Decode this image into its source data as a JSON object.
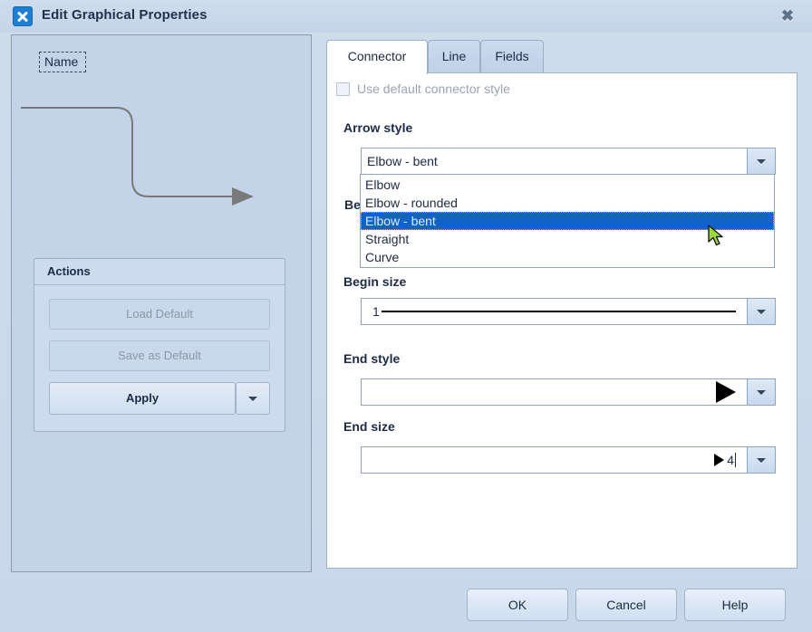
{
  "window": {
    "title": "Edit Graphical Properties",
    "app_icon": "close-x-icon",
    "close_label": "✖"
  },
  "preview": {
    "name_label": "Name",
    "connector_shape": "elbow-rounded-with-arrowhead"
  },
  "actions": {
    "group_title": "Actions",
    "load_default_label": "Load Default",
    "save_as_default_label": "Save as Default",
    "apply_label": "Apply",
    "apply_dropdown_icon": "chevron-down-icon"
  },
  "tabs": [
    {
      "label": "Connector",
      "active": true
    },
    {
      "label": "Line",
      "active": false
    },
    {
      "label": "Fields",
      "active": false
    }
  ],
  "connector_tab": {
    "use_default_checkbox": {
      "label": "Use default connector style",
      "checked": false,
      "enabled": false
    },
    "arrow_style": {
      "label": "Arrow style",
      "value": "Elbow - bent",
      "expanded": true,
      "options": [
        "Elbow",
        "Elbow - rounded",
        "Elbow - bent",
        "Straight",
        "Curve"
      ],
      "selected_index": 2
    },
    "begin_style": {
      "label": "Begin style",
      "visible_text": "Be",
      "value": ""
    },
    "begin_size": {
      "label": "Begin size",
      "value": "1"
    },
    "end_style": {
      "label": "End style",
      "value": "",
      "glyph": "solid-arrowhead"
    },
    "end_size": {
      "label": "End size",
      "value": "4",
      "glyph": "small-arrowhead"
    }
  },
  "footer": {
    "ok_label": "OK",
    "cancel_label": "Cancel",
    "help_label": "Help"
  },
  "colors": {
    "window_bg": "#c8d8ea",
    "panel_bg": "#c3d4e9",
    "highlight": "#1063c4",
    "accent_icon": "#1c7fd4",
    "cursor": "#9cd93a"
  }
}
